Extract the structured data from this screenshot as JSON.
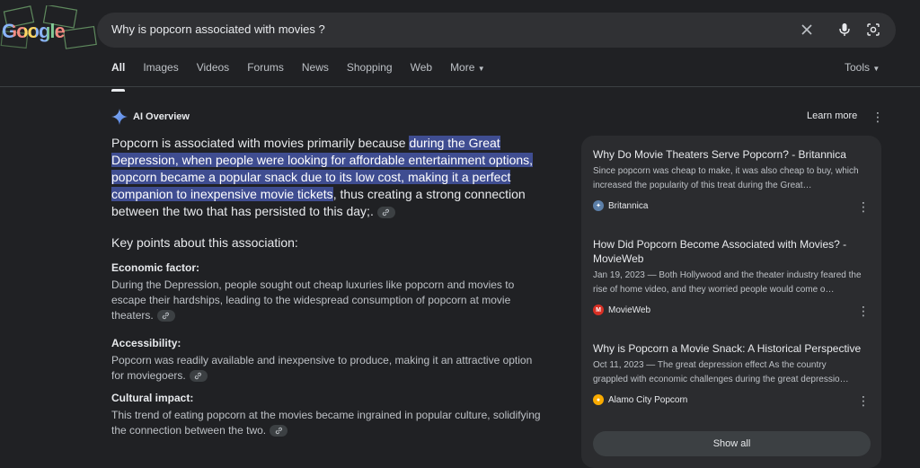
{
  "search": {
    "query": "Why is popcorn associated with movies ?"
  },
  "logo": {
    "text": "Google"
  },
  "tabs": [
    {
      "label": "All"
    },
    {
      "label": "Images"
    },
    {
      "label": "Videos"
    },
    {
      "label": "Forums"
    },
    {
      "label": "News"
    },
    {
      "label": "Shopping"
    },
    {
      "label": "Web"
    },
    {
      "label": "More"
    }
  ],
  "tools_label": "Tools",
  "ai": {
    "title": "AI Overview",
    "learn_more": "Learn more",
    "lead_pre": "Popcorn is associated with movies primarily because ",
    "lead_highlight": "during the Great Depression, when people were looking for affordable entertainment options, popcorn became a popular snack due to its low cost, making it a perfect companion to inexpensive movie tickets",
    "lead_post": ", thus creating a strong connection between the two that has persisted to this day;.",
    "key_points_title": "Key points about this association:",
    "points": [
      {
        "heading": "Economic factor:",
        "text": "During the Depression, people sought out cheap luxuries like popcorn and movies to escape their hardships, leading to the widespread consumption of popcorn at movie theaters."
      },
      {
        "heading": "Accessibility:",
        "text": "Popcorn was readily available and inexpensive to produce, making it an attractive option for moviegoers."
      },
      {
        "heading": "Cultural impact:",
        "text": "This trend of eating popcorn at the movies became ingrained in popular culture, solidifying the connection between the two."
      }
    ]
  },
  "sources": [
    {
      "title": "Why Do Movie Theaters Serve Popcorn? - Britannica",
      "snippet": "Since popcorn was cheap to make, it was also cheap to buy, which increased the popularity of this treat during the Great…",
      "site": "Britannica",
      "color": "#5c7fa8"
    },
    {
      "title": "How Did Popcorn Become Associated with Movies? - MovieWeb",
      "snippet": "Jan 19, 2023 — Both Hollywood and the theater industry feared the rise of home video, and they worried people would come o…",
      "site": "MovieWeb",
      "color": "#d93025"
    },
    {
      "title": "Why is Popcorn a Movie Snack: A Historical Perspective",
      "snippet": "Oct 11, 2023 — The great depression effect As the country grappled with economic challenges during the great depressio…",
      "site": "Alamo City Popcorn",
      "color": "#f9ab00"
    }
  ],
  "show_all": "Show all"
}
